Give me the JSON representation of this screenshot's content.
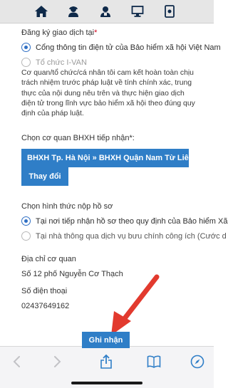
{
  "topnav": {
    "icons": [
      "home-icon",
      "user-support-icon",
      "user-settings-icon",
      "monitor-icon",
      "info-icon"
    ]
  },
  "transaction": {
    "label": "Đăng ký giao dịch tại",
    "required_mark": "*",
    "options": [
      {
        "label": "Cổng thông tin điện tử của Bảo hiểm xã hội Việt Nam",
        "checked": true
      },
      {
        "label": "Tổ chức I-VAN",
        "checked": false,
        "disabled": true
      }
    ]
  },
  "commitment_text": "Cơ quan/tổ chức/cá nhân tôi cam kết hoàn toàn chịu trách nhiệm trước pháp luật về tính chính xác, trung thực của nội dung nêu trên và thực hiện giao dịch điện tử trong lĩnh vực bảo hiểm xã hội theo đúng quy định của pháp luật.",
  "agency": {
    "label": "Chọn cơ quan BHXH tiếp nhận",
    "required_mark": "*:",
    "selected": "BHXH Tp. Hà Nội » BHXH Quận Nam Từ Liêm",
    "change_label": "Thay đổi"
  },
  "submission": {
    "label": "Chọn hình thức nộp hồ sơ",
    "options": [
      {
        "label": "Tại nơi tiếp nhận hồ sơ theo quy định của Bảo hiểm Xã",
        "checked": true
      },
      {
        "label": "Tại nhà thông qua dịch vụ bưu chính công ích (Cước d",
        "checked": false
      }
    ]
  },
  "address": {
    "label": "Địa chỉ cơ quan",
    "value": "Số 12 phố Nguyễn Cơ Thạch"
  },
  "phone": {
    "label": "Số điện thoại",
    "value": "02437649162"
  },
  "submit_label": "Ghi nhận",
  "colors": {
    "accent": "#2f7ec7",
    "radio": "#2f6fc4",
    "arrow": "#e23a2e",
    "required": "#d0021b"
  },
  "bottombar": {
    "icons": [
      "back-chevron-icon",
      "forward-chevron-icon",
      "share-icon",
      "bookmarks-icon",
      "compass-icon"
    ]
  }
}
